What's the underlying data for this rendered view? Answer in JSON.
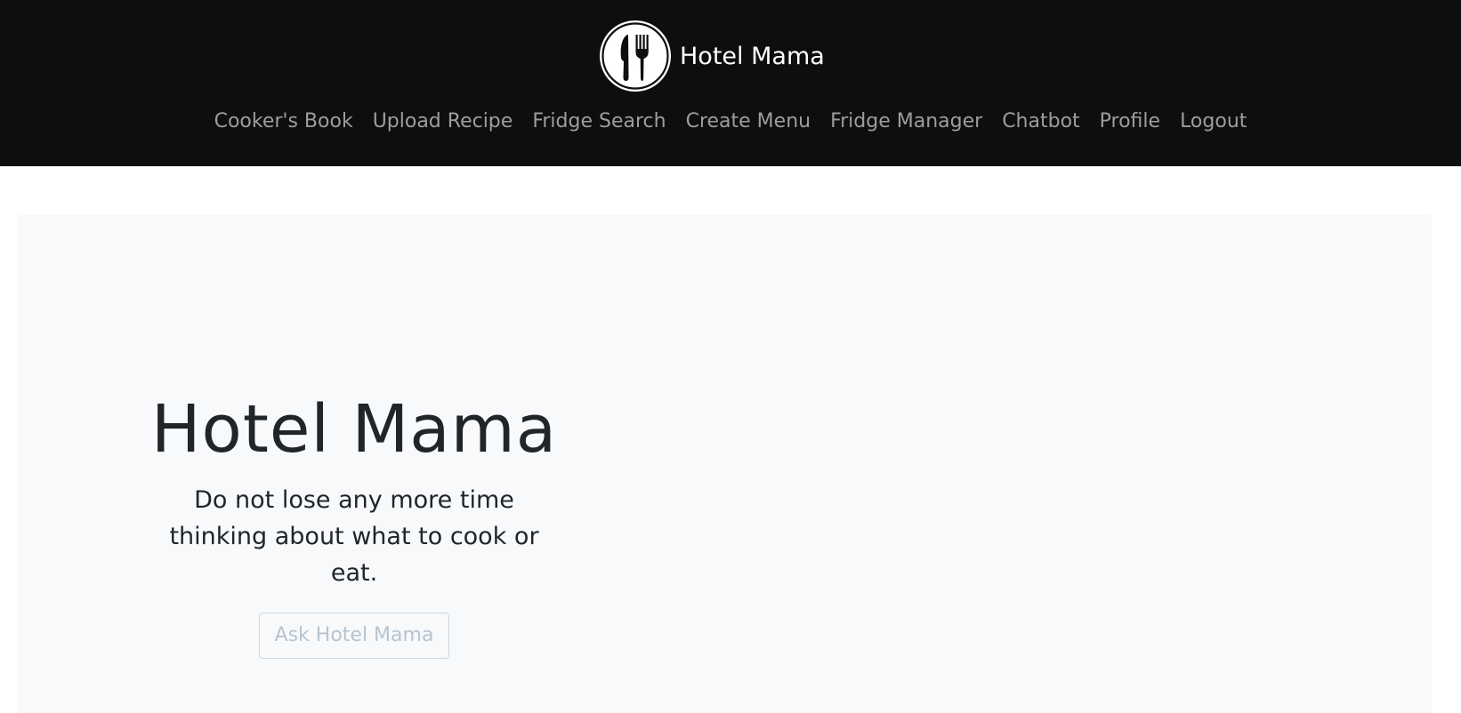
{
  "navbar": {
    "brand_name": "Hotel Mama",
    "logo_icon": "fork-knife-icon",
    "background_color": "#0e0e0e",
    "links": [
      {
        "label": "Cooker's Book"
      },
      {
        "label": "Upload Recipe"
      },
      {
        "label": "Fridge Search"
      },
      {
        "label": "Create Menu"
      },
      {
        "label": "Fridge Manager"
      },
      {
        "label": "Chatbot"
      },
      {
        "label": "Profile"
      },
      {
        "label": "Logout"
      }
    ]
  },
  "hero": {
    "title": "Hotel Mama",
    "subtitle": "Do not lose any more time thinking about what to cook or eat.",
    "button_label": "Ask Hotel Mama",
    "background_color": "#f8f9fa"
  }
}
